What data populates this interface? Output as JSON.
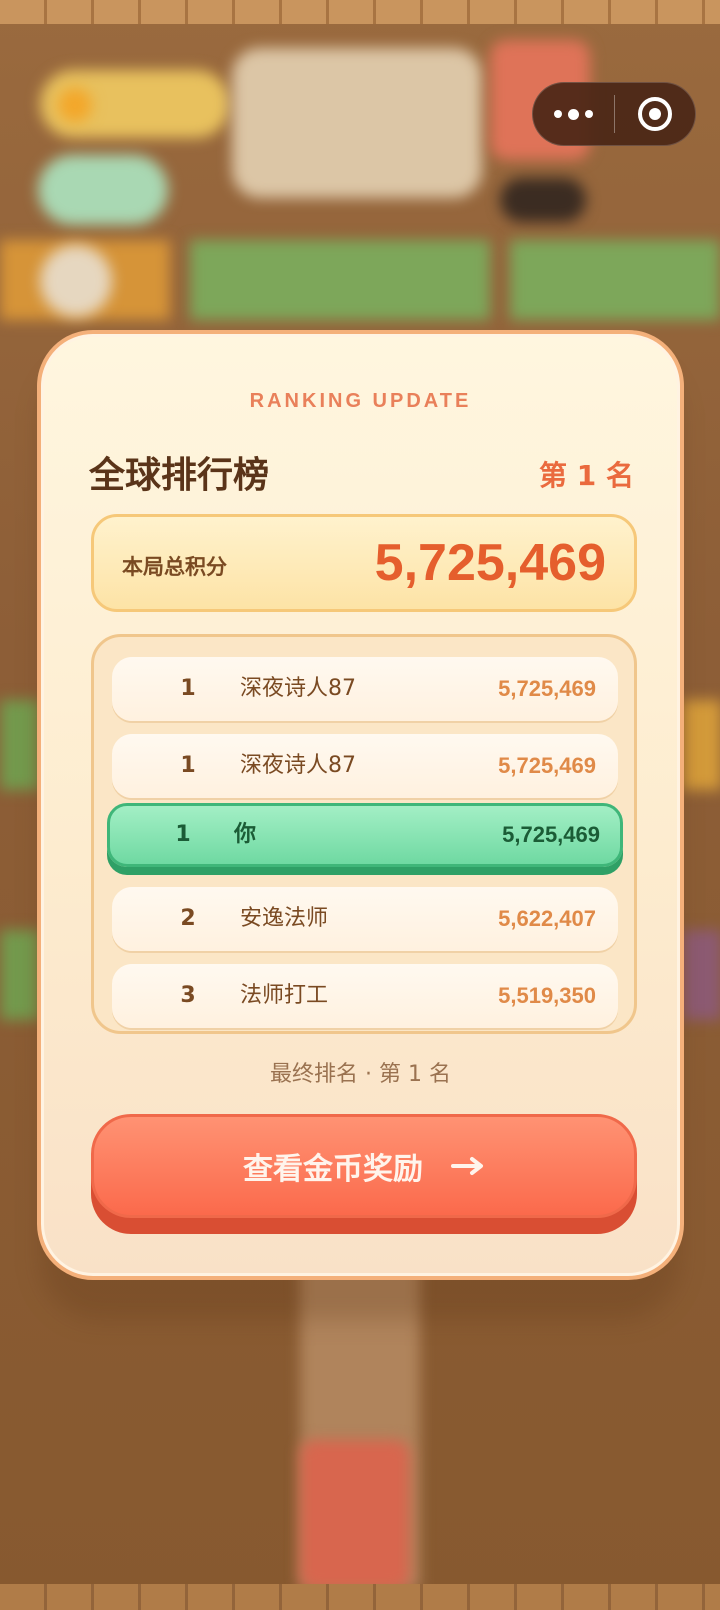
{
  "modal": {
    "kicker": "RANKING UPDATE",
    "title": "全球排行榜",
    "rank_badge": "第 1 名",
    "score_label": "本局总积分",
    "score_value": "5,725,469",
    "rows": [
      {
        "rank": "1",
        "name": "深夜诗人87",
        "score": "5,725,469",
        "is_me": false
      },
      {
        "rank": "1",
        "name": "深夜诗人87",
        "score": "5,725,469",
        "is_me": false
      },
      {
        "rank": "1",
        "name": "你",
        "score": "5,725,469",
        "is_me": true
      },
      {
        "rank": "2",
        "name": "安逸法师",
        "score": "5,622,407",
        "is_me": false
      },
      {
        "rank": "3",
        "name": "法师打工",
        "score": "5,519,350",
        "is_me": false
      }
    ],
    "final_rank_text": "最终排名 · 第 1 名",
    "cta_label": "查看金币奖励",
    "cta_icon": "arrow-right-icon"
  },
  "capsule": {
    "more_icon": "more-dots-icon",
    "close_icon": "target-close-icon"
  },
  "colors": {
    "accent": "#ea6a3e",
    "highlight_row": "#6fd9a2",
    "cta": "#fb6a4c",
    "modal_border": "#f4b07a"
  }
}
